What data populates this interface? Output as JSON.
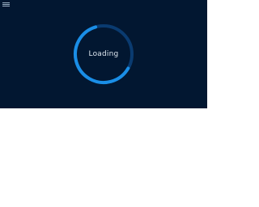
{
  "colors": {
    "hero_background": "#021731",
    "lower_background": "#ffffff",
    "ring_track": "#0a3b70",
    "ring_arc": "#1a8ee6",
    "text": "#dfe7f0",
    "menu_icon": "#9fb3c8"
  },
  "header": {
    "menu_icon": "hamburger-menu-icon"
  },
  "loader": {
    "label": "Loading",
    "progress": 0.62
  }
}
